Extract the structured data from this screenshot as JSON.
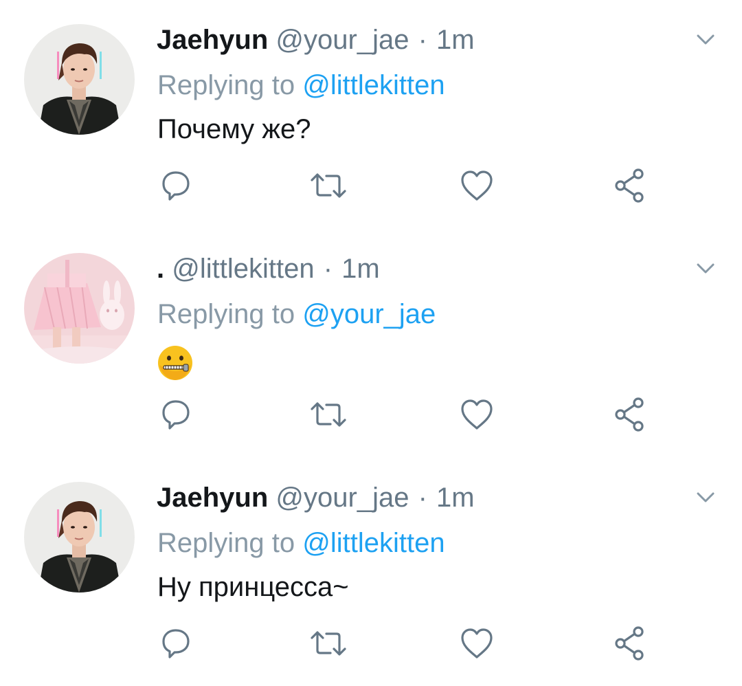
{
  "tweets": [
    {
      "name": "Jaehyun",
      "handle": "@your_jae",
      "separator": "·",
      "time": "1m",
      "replying_prefix": "Replying to",
      "replying_to": "@littlekitten",
      "text": "Почему же?",
      "avatar": "jaehyun-avatar"
    },
    {
      "name": ".",
      "handle": "@littlekitten",
      "separator": "·",
      "time": "1m",
      "replying_prefix": "Replying to",
      "replying_to": "@your_jae",
      "text": "",
      "emoji": "zipper-mouth-face",
      "avatar": "littlekitten-avatar"
    },
    {
      "name": "Jaehyun",
      "handle": "@your_jae",
      "separator": "·",
      "time": "1m",
      "replying_prefix": "Replying to",
      "replying_to": "@littlekitten",
      "text": "Ну принцесса~",
      "avatar": "jaehyun-avatar"
    }
  ],
  "icons": {
    "reply": "reply-icon",
    "retweet": "retweet-icon",
    "like": "heart-icon",
    "share": "share-icon",
    "menu": "chevron-down-icon"
  },
  "colors": {
    "link": "#1da1f2",
    "secondary": "#657786",
    "text": "#14171a",
    "icon": "#657786"
  }
}
